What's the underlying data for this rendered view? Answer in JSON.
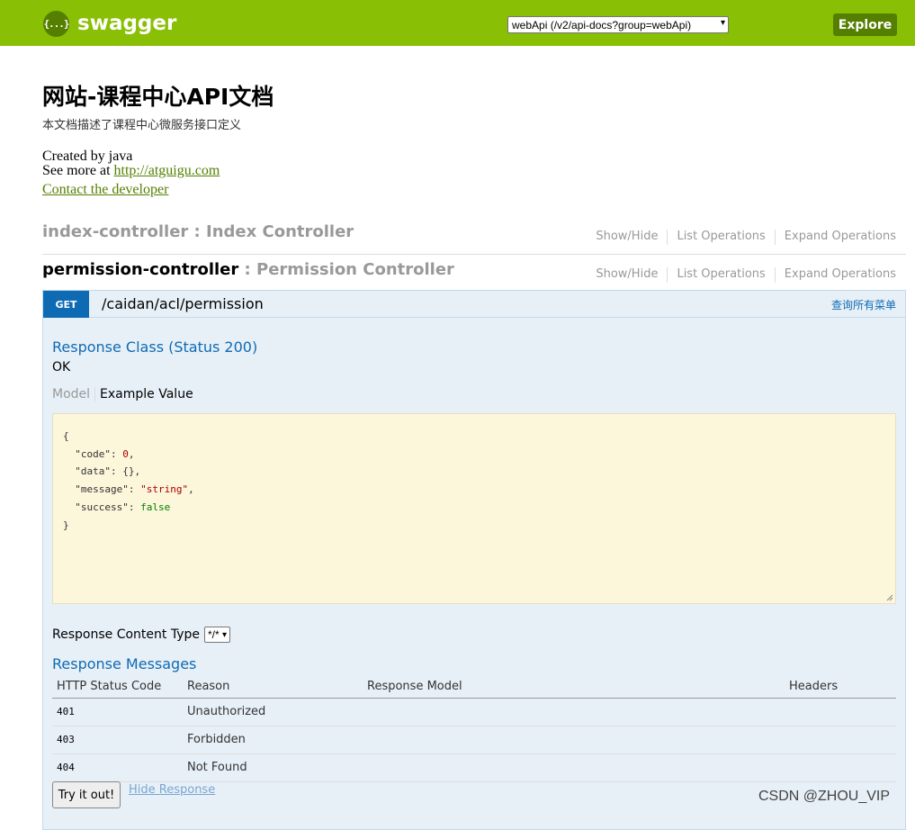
{
  "header": {
    "logo_icon": "{...}",
    "logo_text": "swagger",
    "api_select_value": "webApi (/v2/api-docs?group=webApi)",
    "explore_label": "Explore",
    "brand_color": "#89bf04"
  },
  "info": {
    "title": "网站-课程中心API文档",
    "description": "本文档描述了课程中心微服务接口定义",
    "created_by": "Created by java",
    "see_more_prefix": "See more at ",
    "see_more_link": "http://atguigu.com",
    "contact_link": "Contact the developer"
  },
  "controllers": [
    {
      "name": "index-controller",
      "separator": " : ",
      "description": "Index Controller",
      "show_hide": "Show/Hide",
      "list_operations": "List Operations",
      "expand_operations": "Expand Operations"
    },
    {
      "name": "permission-controller",
      "separator": " : ",
      "description": "Permission Controller",
      "show_hide": "Show/Hide",
      "list_operations": "List Operations",
      "expand_operations": "Expand Operations"
    }
  ],
  "operation": {
    "method": "GET",
    "path": "/caidan/acl/permission",
    "summary": "查询所有菜单",
    "response_class_title": "Response Class (Status 200)",
    "response_class_value": "OK",
    "tab_model": "Model",
    "tab_example": "Example Value",
    "example_lines": {
      "open": "{",
      "code_key": "  \"code\": ",
      "code_val": "0",
      "data_line": "  \"data\": {},",
      "message_key": "  \"message\": ",
      "message_val": "\"string\"",
      "success_key": "  \"success\": ",
      "success_val": "false",
      "close": "}"
    },
    "content_type_label": "Response Content Type",
    "content_type_value": "*/*",
    "response_messages_title": "Response Messages",
    "table_headers": [
      "HTTP Status Code",
      "Reason",
      "Response Model",
      "Headers"
    ],
    "table_rows": [
      {
        "code": "401",
        "reason": "Unauthorized"
      },
      {
        "code": "403",
        "reason": "Forbidden"
      },
      {
        "code": "404",
        "reason": "Not Found"
      }
    ],
    "try_button": "Try it out!",
    "hide_response": "Hide Response"
  },
  "watermark": "CSDN @ZHOU_VIP"
}
